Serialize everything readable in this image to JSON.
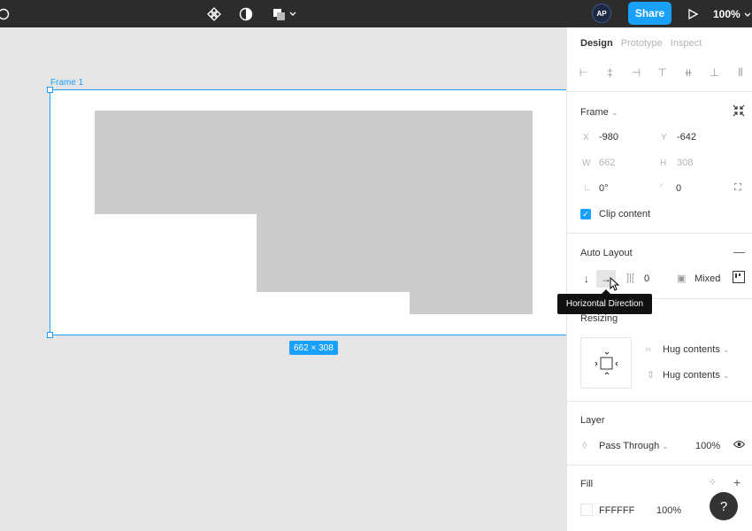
{
  "toolbar": {
    "share_label": "Share",
    "zoom_label": "100%",
    "avatar_initials": "AP",
    "accent": "#18a0fb",
    "background": "#2c2c2c"
  },
  "canvas": {
    "frame_label": "Frame 1",
    "size_badge": "662 × 308"
  },
  "panel": {
    "tabs": [
      "Design",
      "Prototype",
      "Inspect"
    ],
    "frame_section": {
      "title": "Frame",
      "x_label": "X",
      "x_value": "-980",
      "y_label": "Y",
      "y_value": "-642",
      "w_label": "W",
      "w_value": "662",
      "h_label": "H",
      "h_value": "308",
      "rotation_value": "0°",
      "radius_value": "0",
      "clip_content_label": "Clip content",
      "clip_content_checked": true
    },
    "auto_layout": {
      "title": "Auto Layout",
      "spacing_value": "0",
      "padding_label": "Mixed",
      "tooltip": "Horizontal Direction"
    },
    "resizing": {
      "title": "Resizing",
      "horizontal_label": "Hug contents",
      "vertical_label": "Hug contents"
    },
    "layer": {
      "title": "Layer",
      "blend_mode": "Pass Through",
      "opacity": "100%"
    },
    "fill": {
      "title": "Fill",
      "hex": "FFFFFF",
      "opacity": "100%"
    }
  },
  "help_label": "?"
}
